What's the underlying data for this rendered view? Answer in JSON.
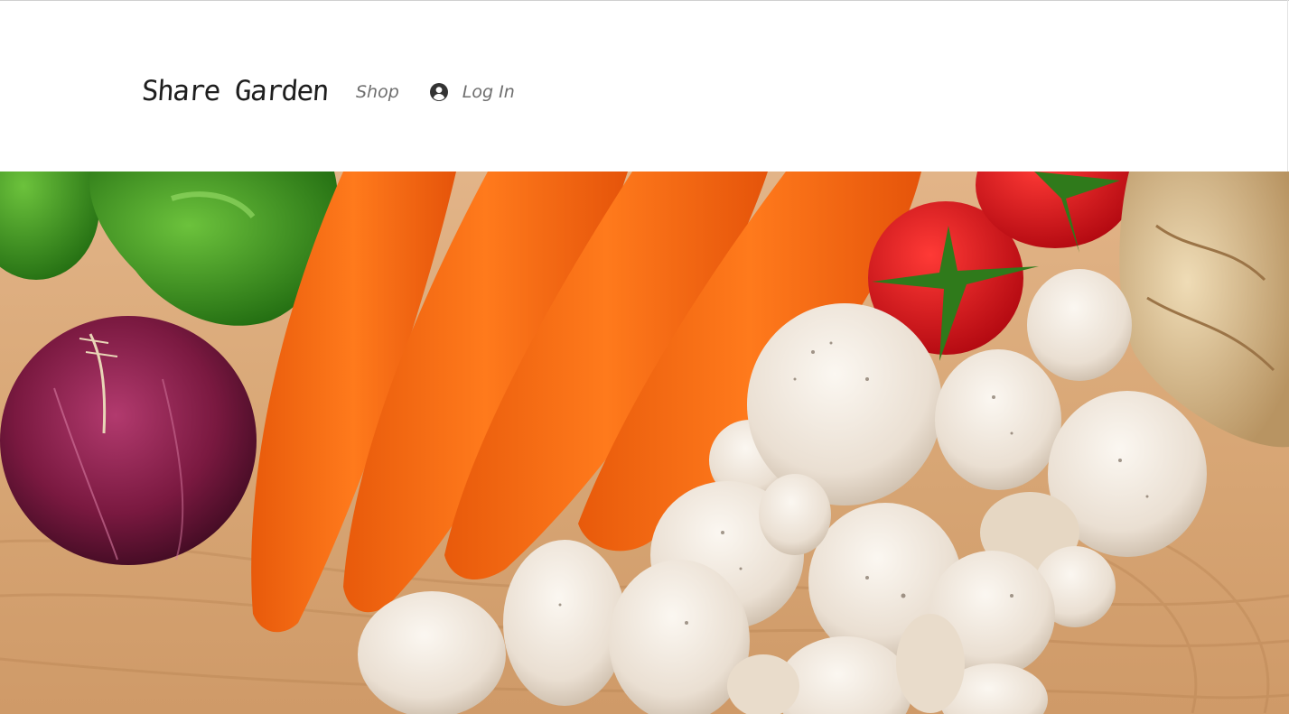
{
  "header": {
    "brand": "Share Garden",
    "nav": {
      "shop_label": "Shop",
      "login_label": "Log In",
      "login_icon": "user-circle-icon"
    }
  },
  "hero": {
    "image": "vegetables-on-wooden-board",
    "colors": {
      "wood": "#d9a877",
      "carrot": "#f26a14",
      "onion": "#6e1538",
      "pepper": "#3e9e1f",
      "tomato": "#d6111a",
      "mushroom": "#efe7de",
      "celeriac": "#dcc39a"
    }
  }
}
